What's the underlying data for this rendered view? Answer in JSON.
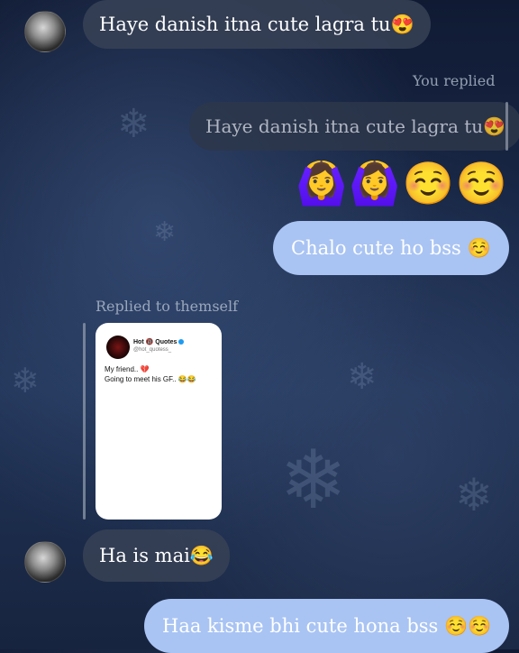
{
  "messages": {
    "m1": {
      "text": "Haye danish itna cute lagra tu😍"
    },
    "reply_meta": "You replied",
    "reply_quote": "Haye danish itna cute lagra tu😍",
    "emoji_reaction": "🙆‍♀️🙆‍♀️☺️☺️",
    "out1": {
      "text": "Chalo cute ho bss ☺️"
    },
    "shared_meta": "Replied to themself",
    "shared_post": {
      "name": "Hot 🔞 Quotes",
      "handle": "@hot_quotess_",
      "text": "My friend.. 💔\nGoing to meet his GF.. 😂😂"
    },
    "m2": {
      "text": "Ha is mai😂"
    },
    "out2": {
      "text": "Haa kisme bhi cute hona bss ☺️☺️"
    }
  },
  "icons": {
    "avatar": "avatar",
    "flake": "snowflake-icon"
  },
  "colors": {
    "outgoing_bubble": "#a9c4f3",
    "incoming_bubble": "#374155"
  }
}
